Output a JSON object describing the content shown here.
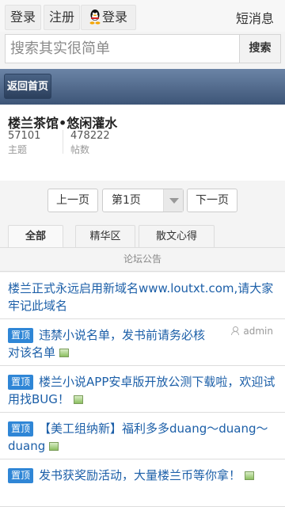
{
  "topbar": {
    "login": "登录",
    "register": "注册",
    "qq_login": "登录",
    "messages": "短消息"
  },
  "search": {
    "placeholder": "搜索其实很简单",
    "button": "搜索"
  },
  "nav": {
    "back_home": "返回首页"
  },
  "forum": {
    "title": "楼兰茶馆•悠闲灌水",
    "topics_count": "57101",
    "topics_label": "主题",
    "posts_count": "478222",
    "posts_label": "帖数"
  },
  "pager": {
    "prev": "上一页",
    "current": "第1页",
    "next": "下一页"
  },
  "tabs": [
    {
      "label": "全部",
      "active": true
    },
    {
      "label": "精华区",
      "active": false
    },
    {
      "label": "散文心得",
      "active": false
    }
  ],
  "announcement_header": "论坛公告",
  "threads": [
    {
      "tag": "",
      "title": "楼兰正式永远启用新域名www.loutxt.com,请大家牢记此域名",
      "has_image": false,
      "author": ""
    },
    {
      "tag": "置顶",
      "title": "违禁小说名单，发书前请务必核对该名单",
      "has_image": true,
      "author": "admin"
    },
    {
      "tag": "置顶",
      "title": "楼兰小说APP安卓版开放公测下载啦，欢迎试用找BUG！",
      "has_image": true,
      "author": ""
    },
    {
      "tag": "置顶",
      "title": "【美工组纳新】福利多多duang～duang～duang",
      "has_image": true,
      "author": ""
    },
    {
      "tag": "置顶",
      "title": "发书获奖励活动，大量楼兰币等你拿！",
      "has_image": true,
      "author": ""
    }
  ],
  "colors": {
    "link": "#1c5fa8",
    "tag_bg": "#2f86d6",
    "nav_bar": "#4a6385"
  }
}
